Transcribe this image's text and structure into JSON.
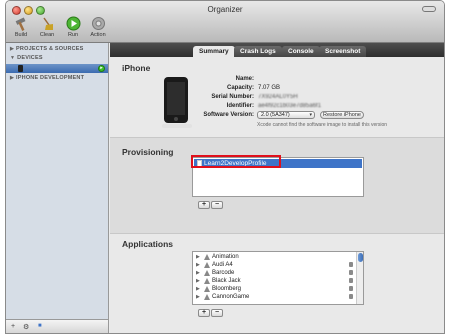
{
  "window": {
    "title": "Organizer"
  },
  "toolbar": {
    "items": [
      {
        "label": "Build"
      },
      {
        "label": "Clean"
      },
      {
        "label": "Run"
      },
      {
        "label": "Action"
      }
    ]
  },
  "sidebar": {
    "sections": [
      {
        "label": "PROJECTS & SOURCES"
      },
      {
        "label": "DEVICES"
      },
      {
        "label": "IPHONE DEVELOPMENT"
      }
    ],
    "selected_badge": "▸",
    "footer": {
      "add": "+",
      "action": "⚙",
      "badge": "■"
    }
  },
  "tabs": [
    {
      "label": "Summary",
      "active": true
    },
    {
      "label": "Crash Logs"
    },
    {
      "label": "Console"
    },
    {
      "label": "Screenshot"
    }
  ],
  "device": {
    "section_title": "iPhone",
    "fields": [
      {
        "key": "Name:",
        "value": ""
      },
      {
        "key": "Capacity:",
        "value": "7.07 GB"
      },
      {
        "key": "Serial Number:",
        "value": "7X924AL0Y5H"
      },
      {
        "key": "Identifier:",
        "value": "ae4f92c1b03e7d85a6f1"
      },
      {
        "key": "Software Version:",
        "value": ""
      }
    ],
    "software_version": "2.0 (5A347)",
    "restore_label": "Restore iPhone",
    "note": "Xcode cannot find the software image to install this version"
  },
  "provisioning": {
    "section_title": "Provisioning",
    "profiles": [
      "Learn2DevelopProfile"
    ],
    "add": "+",
    "remove": "−"
  },
  "applications": {
    "section_title": "Applications",
    "items": [
      "Animation",
      "Audi A4",
      "Barcode",
      "Black Jack",
      "Bloomberg",
      "CannonGame"
    ],
    "add": "+",
    "remove": "−"
  },
  "colors": {
    "selection": "#3e74c8",
    "highlight_box": "#e0101b",
    "sidebar_bg": "#d6dde6"
  }
}
